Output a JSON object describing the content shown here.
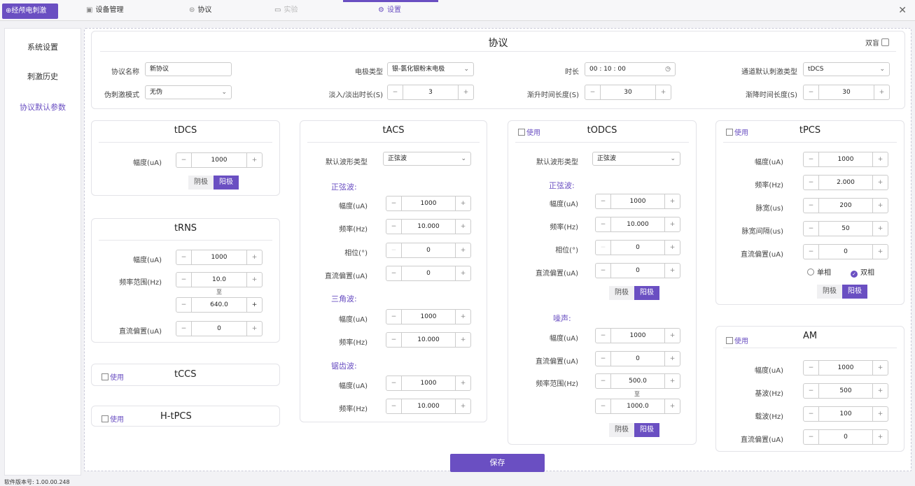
{
  "brand": "⊕经颅电刺激",
  "tabs": {
    "device": "设备管理",
    "protocol": "协议",
    "experiment": "实验",
    "settings": "设置"
  },
  "sidebar": [
    "系统设置",
    "刺激历史",
    "协议默认参数"
  ],
  "protocol_panel": {
    "title": "协议",
    "double_blind": "双盲",
    "name_label": "协议名称",
    "name_value": "新协议",
    "electrode_label": "电极类型",
    "electrode_value": "银-氯化银粉末电极",
    "duration_label": "时长",
    "duration_value": "00 : 10 : 00",
    "channel_label": "通道默认刺激类型",
    "channel_value": "tDCS",
    "sham_label": "伪刺激模式",
    "sham_value": "无伪",
    "fade_label": "淡入/淡出时长(S)",
    "fade_value": "3",
    "rise_label": "渐升时间长度(S)",
    "rise_value": "30",
    "fall_label": "渐降时间长度(S)",
    "fall_value": "30"
  },
  "common": {
    "use": "使用",
    "cathode": "阴极",
    "anode": "阳极",
    "to": "至",
    "minus": "−",
    "plus": "+",
    "chevron": "⌄"
  },
  "tdcs": {
    "title": "tDCS",
    "amp_label": "幅度(uA)",
    "amp": "1000"
  },
  "trns": {
    "title": "tRNS",
    "amp_label": "幅度(uA)",
    "amp": "1000",
    "freq_label": "频率范围(Hz)",
    "freq_min": "10.0",
    "freq_max": "640.0",
    "dc_label": "直流偏置(uA)",
    "dc": "0"
  },
  "tccs": {
    "title": "tCCS"
  },
  "htpcs": {
    "title": "H-tPCS"
  },
  "tacs": {
    "title": "tACS",
    "wave_label": "默认波形类型",
    "wave_value": "正弦波",
    "sine_title": "正弦波:",
    "amp_label": "幅度(uA)",
    "freq_label": "频率(Hz)",
    "phase_label": "相位(°)",
    "dc_label": "直流偏置(uA)",
    "sine_amp": "1000",
    "sine_freq": "10.000",
    "sine_phase": "0",
    "sine_dc": "0",
    "tri_title": "三角波:",
    "tri_amp": "1000",
    "tri_freq": "10.000",
    "saw_title": "锯齿波:",
    "saw_amp": "1000",
    "saw_freq": "10.000"
  },
  "todcs": {
    "title": "tODCS",
    "wave_label": "默认波形类型",
    "wave_value": "正弦波",
    "sine_title": "正弦波:",
    "amp_label": "幅度(uA)",
    "freq_label": "频率(Hz)",
    "phase_label": "相位(°)",
    "dc_label": "直流偏置(uA)",
    "sine_amp": "1000",
    "sine_freq": "10.000",
    "sine_phase": "0",
    "sine_dc": "0",
    "noise_title": "噪声:",
    "noise_amp": "1000",
    "noise_dc": "0",
    "range_label": "频率范围(Hz)",
    "range_min": "500.0",
    "range_max": "1000.0"
  },
  "tpcs": {
    "title": "tPCS",
    "amp_label": "幅度(uA)",
    "amp": "1000",
    "freq_label": "频率(Hz)",
    "freq": "2.000",
    "pw_label": "脉宽(us)",
    "pw": "200",
    "gap_label": "脉宽间隔(us)",
    "gap": "50",
    "dc_label": "直流偏置(uA)",
    "dc": "0",
    "mono": "单相",
    "bi": "双相"
  },
  "am": {
    "title": "AM",
    "amp_label": "幅度(uA)",
    "amp": "1000",
    "base_label": "基波(Hz)",
    "base": "500",
    "carrier_label": "载波(Hz)",
    "carrier": "100",
    "dc_label": "直流偏置(uA)",
    "dc": "0"
  },
  "save": "保存",
  "version": "软件版本号: 1.00.00.248",
  "accent": "#6a4fc2"
}
